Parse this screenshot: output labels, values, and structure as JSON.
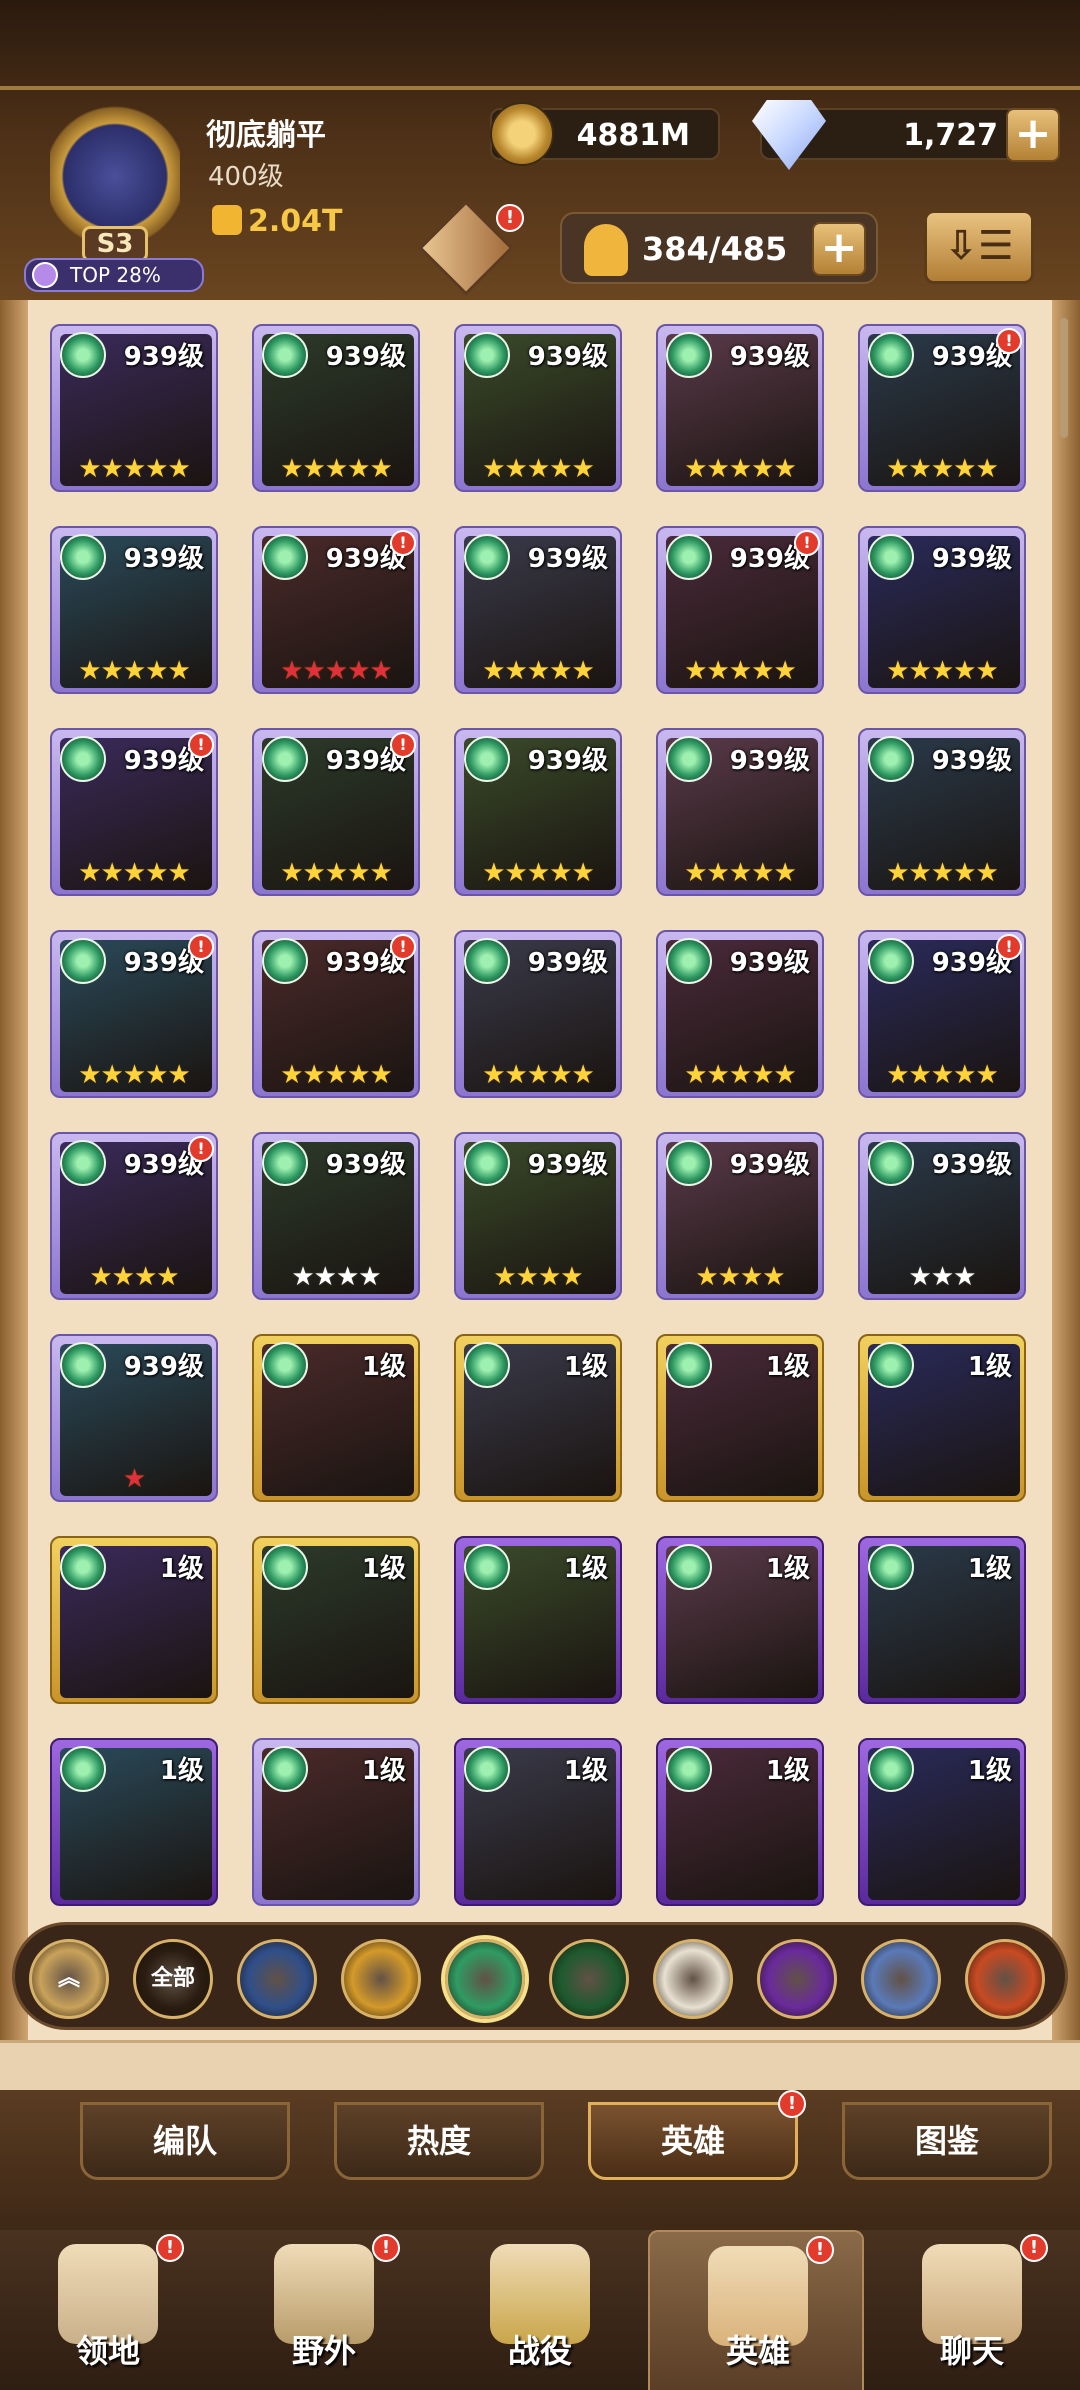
{
  "player": {
    "name": "彻底躺平",
    "level": "400级",
    "season": "S3",
    "rank": "TOP 28%",
    "power": "2.04T"
  },
  "currency": {
    "gold": "4881M",
    "diamonds": "1,727"
  },
  "hero_count": "384/485",
  "badges": {
    "dot": "!"
  },
  "heroes": [
    {
      "level": "939级",
      "stars": "★★★★★",
      "star_style": "gold",
      "frame": "purple",
      "alert": false
    },
    {
      "level": "939级",
      "stars": "★★★★★",
      "star_style": "gold",
      "frame": "purple",
      "alert": false
    },
    {
      "level": "939级",
      "stars": "★★★★★",
      "star_style": "gold",
      "frame": "purple",
      "alert": false
    },
    {
      "level": "939级",
      "stars": "★★★★★",
      "star_style": "gold",
      "frame": "purple",
      "alert": false
    },
    {
      "level": "939级",
      "stars": "★★★★★",
      "star_style": "gold",
      "frame": "purple",
      "alert": true
    },
    {
      "level": "939级",
      "stars": "★★★★★",
      "star_style": "gold",
      "frame": "purple",
      "alert": false
    },
    {
      "level": "939级",
      "stars": "★★★★★",
      "star_style": "red",
      "frame": "purple",
      "alert": true
    },
    {
      "level": "939级",
      "stars": "★★★★★",
      "star_style": "gold",
      "frame": "purple",
      "alert": false
    },
    {
      "level": "939级",
      "stars": "★★★★★",
      "star_style": "gold",
      "frame": "purple",
      "alert": true
    },
    {
      "level": "939级",
      "stars": "★★★★★",
      "star_style": "gold",
      "frame": "purple",
      "alert": false
    },
    {
      "level": "939级",
      "stars": "★★★★★",
      "star_style": "gold",
      "frame": "purple",
      "alert": true
    },
    {
      "level": "939级",
      "stars": "★★★★★",
      "star_style": "gold",
      "frame": "purple",
      "alert": true
    },
    {
      "level": "939级",
      "stars": "★★★★★",
      "star_style": "gold",
      "frame": "purple",
      "alert": false
    },
    {
      "level": "939级",
      "stars": "★★★★★",
      "star_style": "gold",
      "frame": "purple",
      "alert": false
    },
    {
      "level": "939级",
      "stars": "★★★★★",
      "star_style": "gold",
      "frame": "purple",
      "alert": false
    },
    {
      "level": "939级",
      "stars": "★★★★★",
      "star_style": "gold",
      "frame": "purple",
      "alert": true
    },
    {
      "level": "939级",
      "stars": "★★★★★",
      "star_style": "gold",
      "frame": "purple",
      "alert": true
    },
    {
      "level": "939级",
      "stars": "★★★★★",
      "star_style": "gold",
      "frame": "purple",
      "alert": false
    },
    {
      "level": "939级",
      "stars": "★★★★★",
      "star_style": "gold",
      "frame": "purple",
      "alert": false
    },
    {
      "level": "939级",
      "stars": "★★★★★",
      "star_style": "gold",
      "frame": "purple",
      "alert": true
    },
    {
      "level": "939级",
      "stars": "★★★★",
      "star_style": "gold",
      "frame": "purple",
      "alert": true
    },
    {
      "level": "939级",
      "stars": "★★★★",
      "star_style": "white",
      "frame": "purple",
      "alert": false
    },
    {
      "level": "939级",
      "stars": "★★★★",
      "star_style": "gold",
      "frame": "purple",
      "alert": false
    },
    {
      "level": "939级",
      "stars": "★★★★",
      "star_style": "gold",
      "frame": "purple",
      "alert": false
    },
    {
      "level": "939级",
      "stars": "★★★",
      "star_style": "white",
      "frame": "purple",
      "alert": false
    },
    {
      "level": "939级",
      "stars": "★",
      "star_style": "red",
      "frame": "purple",
      "alert": false
    },
    {
      "level": "1级",
      "stars": "",
      "star_style": "gold",
      "frame": "gold",
      "alert": false
    },
    {
      "level": "1级",
      "stars": "",
      "star_style": "gold",
      "frame": "gold",
      "alert": false
    },
    {
      "level": "1级",
      "stars": "",
      "star_style": "gold",
      "frame": "gold",
      "alert": false
    },
    {
      "level": "1级",
      "stars": "",
      "star_style": "gold",
      "frame": "gold",
      "alert": false
    },
    {
      "level": "1级",
      "stars": "",
      "star_style": "gold",
      "frame": "gold",
      "alert": false
    },
    {
      "level": "1级",
      "stars": "",
      "star_style": "gold",
      "frame": "gold",
      "alert": false
    },
    {
      "level": "1级",
      "stars": "",
      "star_style": "gold",
      "frame": "violet",
      "alert": false
    },
    {
      "level": "1级",
      "stars": "",
      "star_style": "gold",
      "frame": "violet",
      "alert": false
    },
    {
      "level": "1级",
      "stars": "",
      "star_style": "gold",
      "frame": "violet",
      "alert": false
    },
    {
      "level": "1级",
      "stars": "",
      "star_style": "gold",
      "frame": "violet",
      "alert": false
    },
    {
      "level": "1级",
      "stars": "",
      "star_style": "gold",
      "frame": "purple",
      "alert": false
    },
    {
      "level": "1级",
      "stars": "",
      "star_style": "gold",
      "frame": "violet",
      "alert": false
    },
    {
      "level": "1级",
      "stars": "",
      "star_style": "gold",
      "frame": "violet",
      "alert": false
    },
    {
      "level": "1级",
      "stars": "",
      "star_style": "gold",
      "frame": "violet",
      "alert": false
    }
  ],
  "filters": [
    {
      "label": "",
      "icon": "collapse-chevron-icon",
      "color": "#c9a25a"
    },
    {
      "label": "全部",
      "icon": "all-icon",
      "color": "#2a1c10"
    },
    {
      "label": "",
      "icon": "lightbearer-icon",
      "color": "#2f4f8a"
    },
    {
      "label": "",
      "icon": "mauler-icon",
      "color": "#d49a2a"
    },
    {
      "label": "",
      "icon": "wilder-icon",
      "color": "#2f9b63"
    },
    {
      "label": "",
      "icon": "graveborn-icon",
      "color": "#1e5a2e"
    },
    {
      "label": "",
      "icon": "celestial-icon",
      "color": "#e8e0d0"
    },
    {
      "label": "",
      "icon": "hypogean-icon",
      "color": "#6a2a9c"
    },
    {
      "label": "",
      "icon": "dimensional-icon",
      "color": "#5a7ab8"
    },
    {
      "label": "",
      "icon": "fire-icon",
      "color": "#c84a22"
    }
  ],
  "subtabs": [
    {
      "label": "编队",
      "alert": false
    },
    {
      "label": "热度",
      "alert": false
    },
    {
      "label": "英雄",
      "alert": true
    },
    {
      "label": "图鉴",
      "alert": false
    }
  ],
  "nav": [
    {
      "label": "领地",
      "icon": "castle-icon",
      "alert": true
    },
    {
      "label": "野外",
      "icon": "map-icon",
      "alert": true
    },
    {
      "label": "战役",
      "icon": "sword-icon",
      "alert": false
    },
    {
      "label": "英雄",
      "icon": "helmet-icon",
      "alert": true
    },
    {
      "label": "聊天",
      "icon": "chat-icon",
      "alert": true
    }
  ]
}
